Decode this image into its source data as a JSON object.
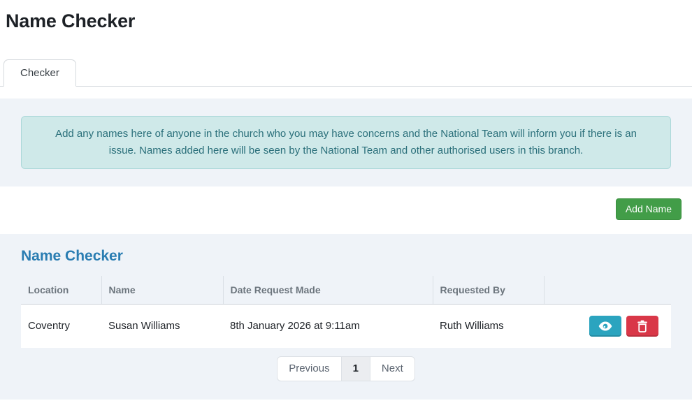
{
  "page": {
    "title": "Name Checker"
  },
  "tabs": {
    "checker_label": "Checker"
  },
  "notice": {
    "text": "Add any names here of anyone in the church who you may have concerns and the National Team will inform you if there is an issue. Names added here will be seen by the National Team and other authorised users in this branch."
  },
  "toolbar": {
    "add_name_label": "Add Name"
  },
  "card": {
    "heading": "Name Checker",
    "table": {
      "headers": {
        "location": "Location",
        "name": "Name",
        "date_request_made": "Date Request Made",
        "requested_by": "Requested By",
        "actions": ""
      },
      "rows": [
        {
          "location": "Coventry",
          "name": "Susan Williams",
          "date_request_made": "8th January 2026 at 9:11am",
          "requested_by": "Ruth Williams"
        }
      ]
    },
    "pagination": {
      "previous_label": "Previous",
      "current_page": "1",
      "next_label": "Next"
    }
  },
  "icons": {
    "view_action": "eye-icon",
    "delete_action": "trash-icon"
  },
  "colors": {
    "heading_blue": "#2a7db2",
    "add_button_green": "#429d48",
    "view_button_teal": "#2ba4bf",
    "delete_button_red": "#d93748",
    "alert_background": "#cfe9e9",
    "alert_text": "#2a6f7a",
    "section_background": "#eff3f8"
  }
}
